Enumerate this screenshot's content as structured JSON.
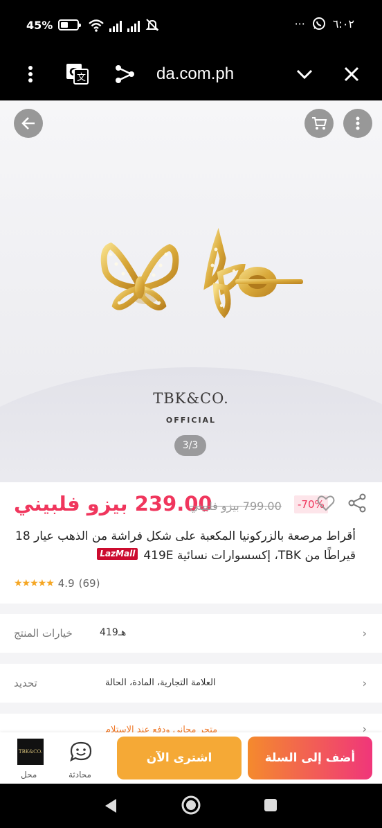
{
  "status_bar": {
    "battery_percent": "45%",
    "battery_level": 0.45,
    "time": "٦:٠٢",
    "more_dots": "···"
  },
  "browser": {
    "url": "da.com.ph"
  },
  "gallery": {
    "brand_name": "TBK&CO.",
    "brand_sub": "OFFICIAL",
    "counter": "3/3"
  },
  "product": {
    "price": "239.00 بيزو فلبيني",
    "old_price": "799.00 بيزو فلبيني",
    "discount": "-70%",
    "badge": "LazMall",
    "title": "أقراط مرصعة بالزركونيا المكعبة على شكل فراشة من الذهب عيار 18 قيراطًا من TBK، إكسسوارات نسائية 419E",
    "rating_value": "4.9",
    "rating_count": "(69)",
    "stars": 4.5,
    "colors": {
      "accent": "#f0365d",
      "badge": "#cc0c2f"
    }
  },
  "options": {
    "variants_label": "خيارات المنتج",
    "variants_value": "419هـ",
    "specs_label": "تحديد",
    "specs_value": "العلامة التجارية، المادة، الحالة",
    "promo_text": "متجر مجاني ودفع عند الاستلام"
  },
  "actions": {
    "store_logo": "TBK&CO.",
    "store_label": "محل",
    "chat_label": "محادثة",
    "buy_now": "اشترى الآن",
    "add_to_cart": "أضف إلى السلة",
    "colors": {
      "buy": "#f5a936",
      "cart_start": "#f48a2d",
      "cart_end": "#f0367a"
    }
  }
}
